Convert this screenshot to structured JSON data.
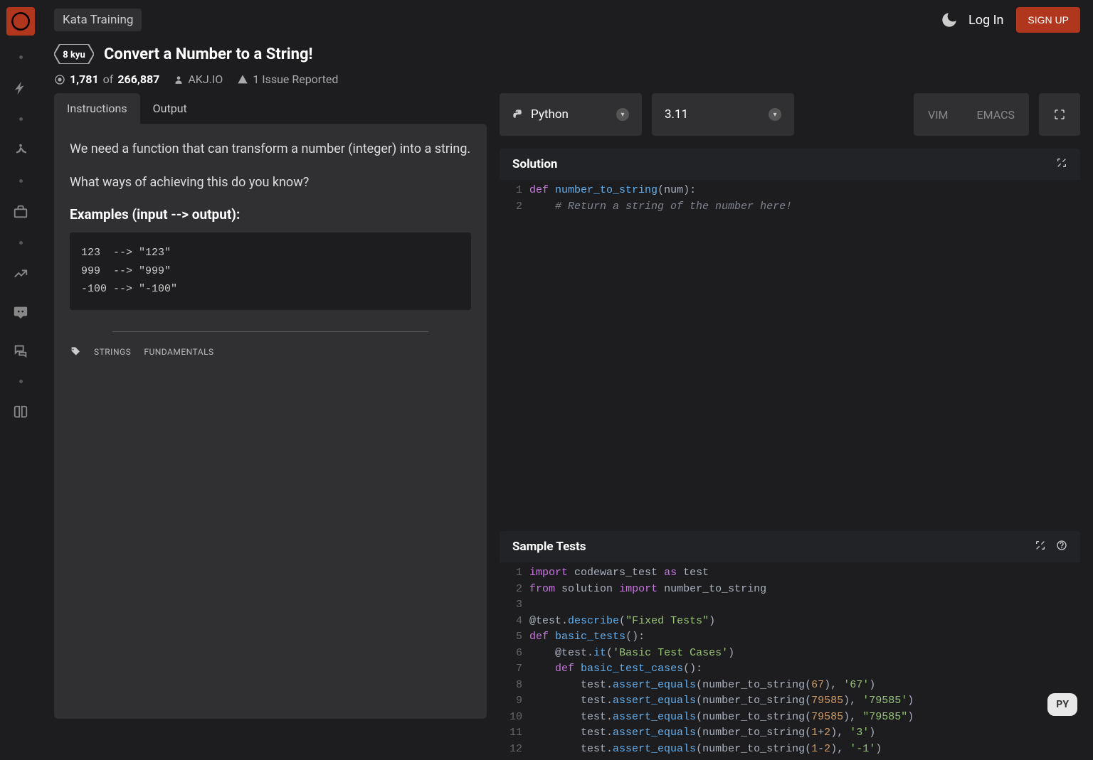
{
  "breadcrumb": "Kata Training",
  "login": "Log In",
  "signup": "SIGN UP",
  "kyu": "8 kyu",
  "title": "Convert a Number to a String!",
  "stats": {
    "done": "1,781",
    "of": "of",
    "total": "266,887"
  },
  "author": "AKJ.IO",
  "issues": "1 Issue Reported",
  "tabs": {
    "instructions": "Instructions",
    "output": "Output"
  },
  "desc": {
    "p1": "We need a function that can transform a number (integer) into a string.",
    "p2": "What ways of achieving this do you know?",
    "exHead": "Examples (input --> output):",
    "ex": "123  --> \"123\"\n999  --> \"999\"\n-100 --> \"-100\""
  },
  "tags": [
    "STRINGS",
    "FUNDAMENTALS"
  ],
  "lang": {
    "name": "Python",
    "version": "3.11"
  },
  "modes": {
    "vim": "VIM",
    "emacs": "EMACS"
  },
  "solution": {
    "title": "Solution"
  },
  "tests": {
    "title": "Sample Tests"
  },
  "badge": "PY"
}
